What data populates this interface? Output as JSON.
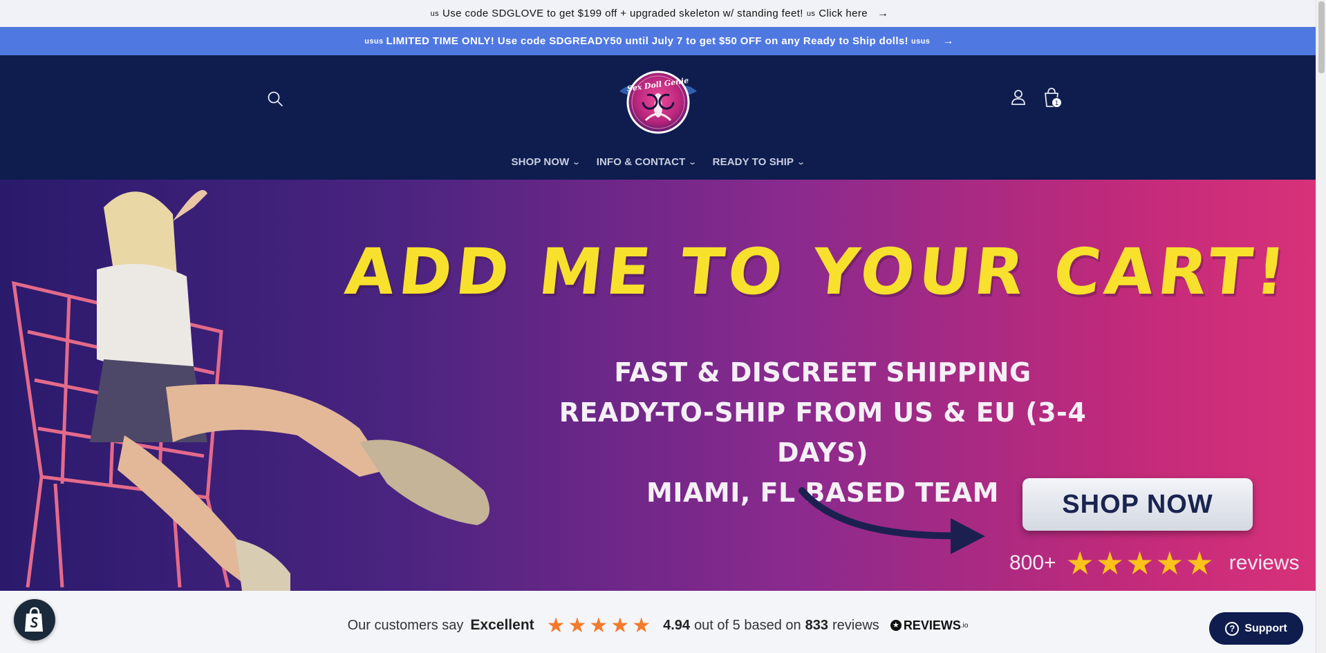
{
  "announcement_top": {
    "flag_left": "us",
    "text": "Use code SDGLOVE to get $199 off + upgraded skeleton w/ standing feet!",
    "flag_right": "us",
    "link": "Click here",
    "arrow_icon": "arrow-right-icon"
  },
  "announcement_promo": {
    "flag_left": "usus",
    "text": "LIMITED TIME ONLY! Use code SDGREADY50 until July 7 to get $50 OFF on any Ready to Ship dolls!",
    "flag_right": "usus",
    "arrow_icon": "arrow-right-icon",
    "background": "#4f78e0"
  },
  "header": {
    "background": "#0e1d4e",
    "logo_text": "Sex Doll Genie",
    "cart_count": "1",
    "nav": [
      {
        "label": "SHOP NOW"
      },
      {
        "label": "INFO & CONTACT"
      },
      {
        "label": "READY TO SHIP"
      }
    ]
  },
  "hero": {
    "headline": "ADD ME TO YOUR CART!",
    "lines": [
      "FAST & DISCREET SHIPPING",
      "READY-TO-SHIP FROM US & EU (3-4 DAYS)",
      "MIAMI, FL BASED TEAM"
    ],
    "cta": "SHOP NOW",
    "review_count": "800+",
    "review_stars": "★★★★★",
    "review_word": "reviews",
    "headline_color": "#f8e12d"
  },
  "reviews_bar": {
    "prefix": "Our customers say",
    "rating_word": "Excellent",
    "stars": "★★★★★",
    "score": "4.94",
    "mid": "out of 5 based on",
    "count": "833",
    "suffix": "reviews",
    "provider": "REVIEWS",
    "provider_suffix": ".io",
    "star_color": "#f37a2b"
  },
  "support": {
    "label": "Support"
  }
}
